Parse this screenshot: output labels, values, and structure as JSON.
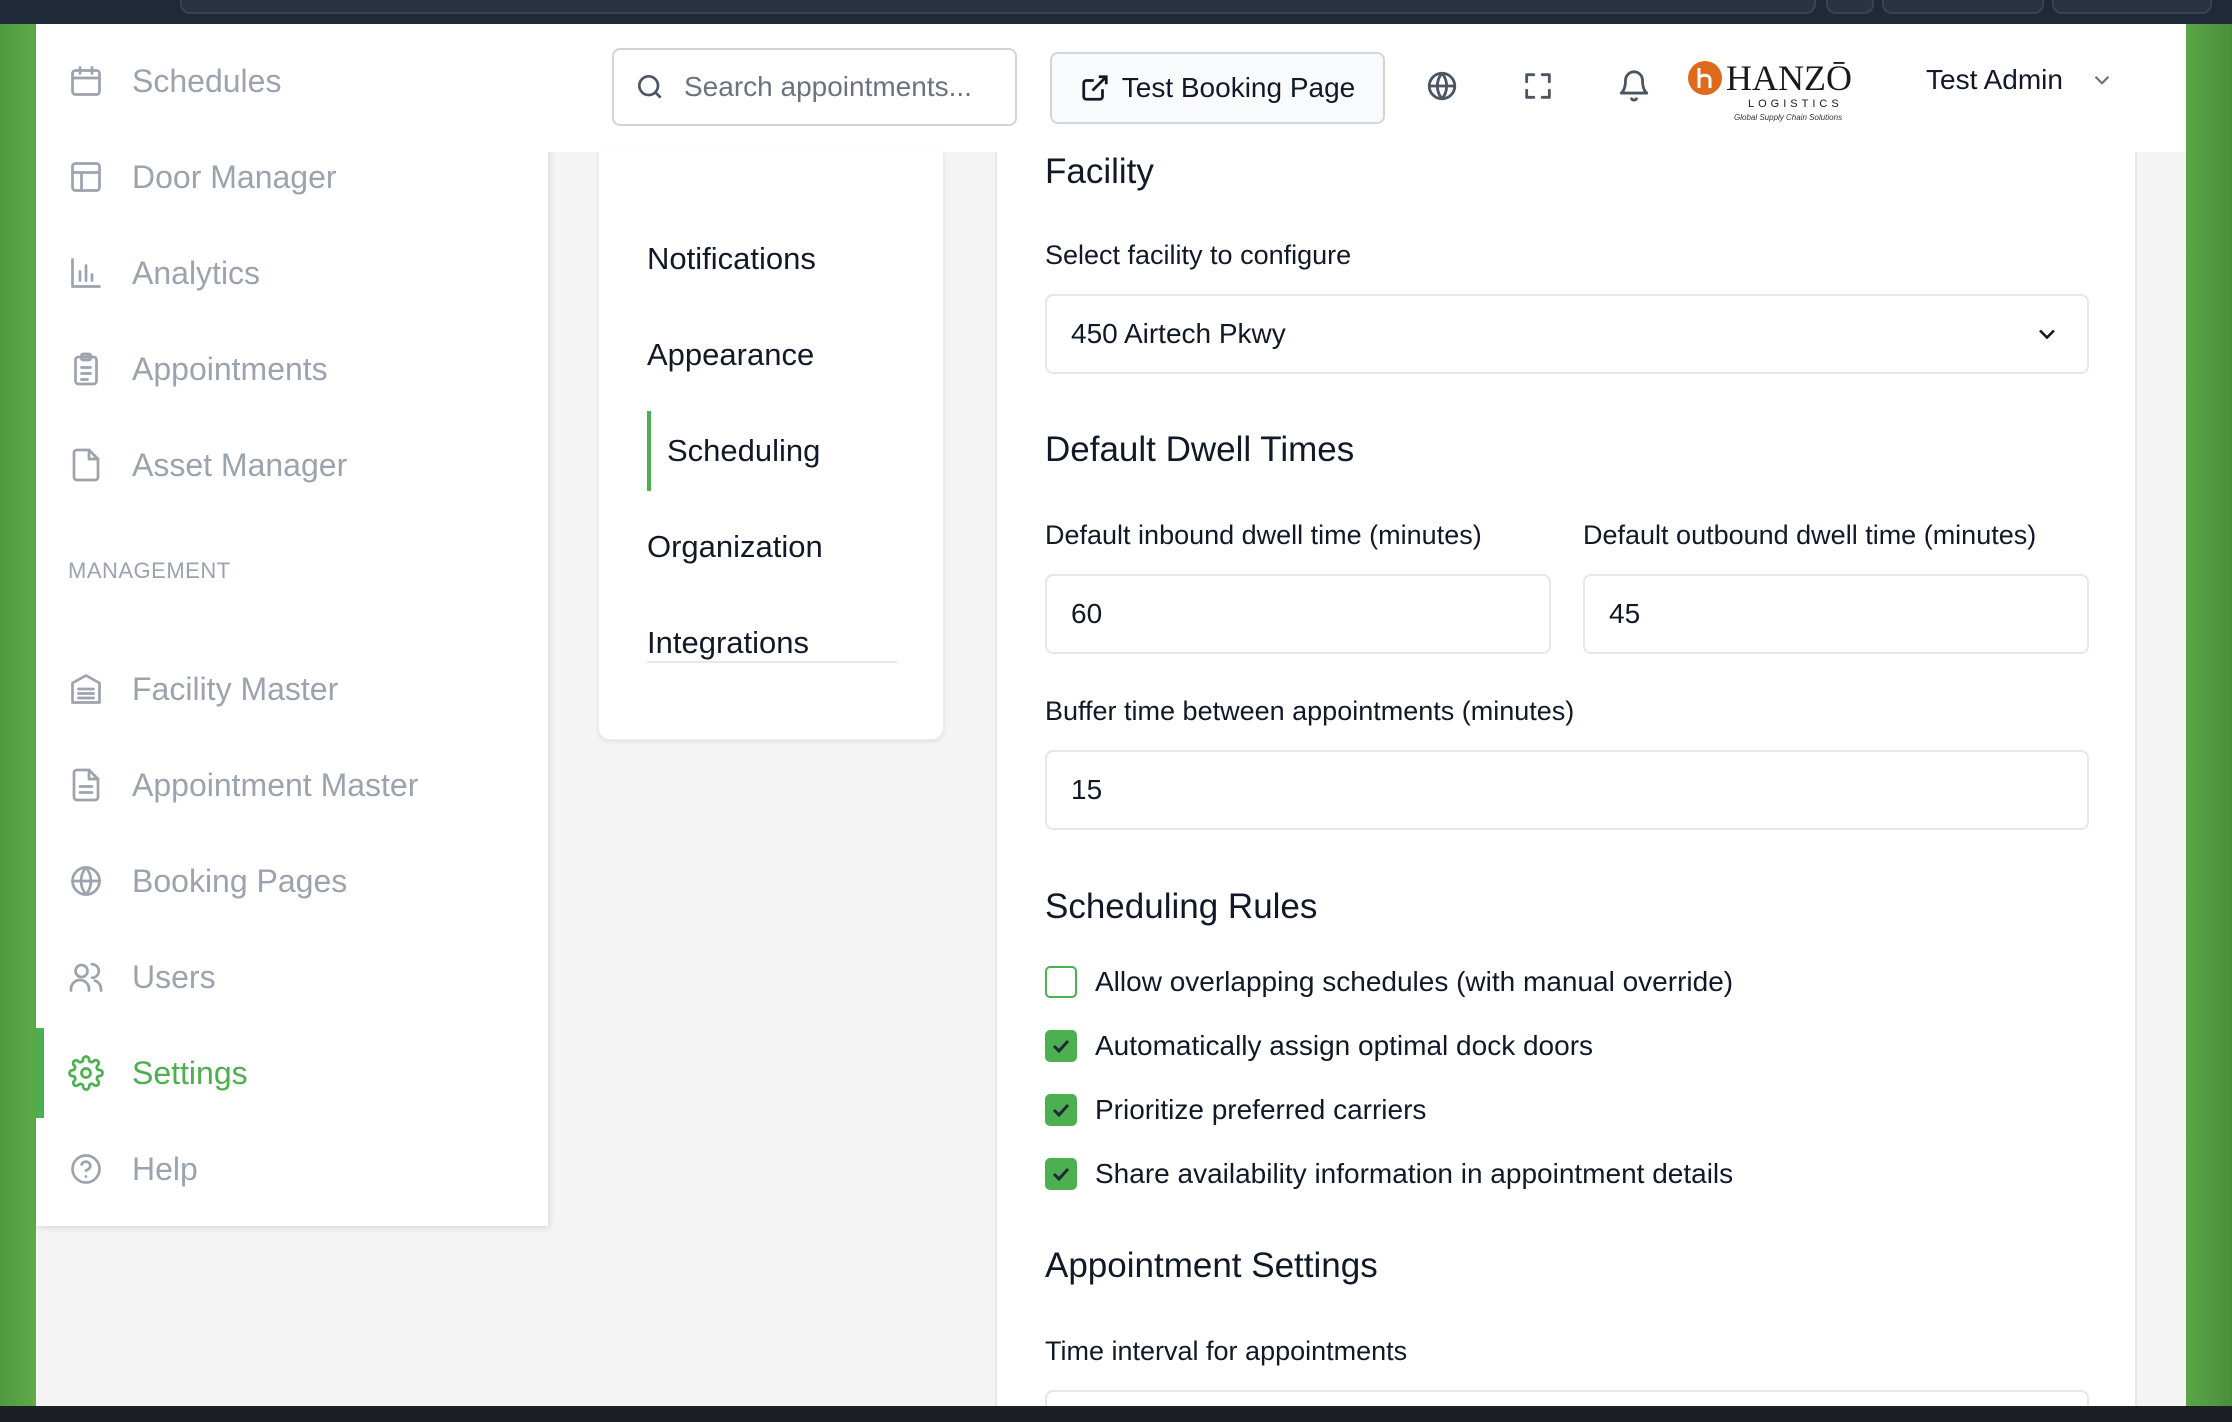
{
  "sidebar": {
    "items": [
      {
        "label": "Schedules",
        "icon": "calendar-icon"
      },
      {
        "label": "Door Manager",
        "icon": "layout-icon"
      },
      {
        "label": "Analytics",
        "icon": "bar-chart-icon"
      },
      {
        "label": "Appointments",
        "icon": "clipboard-icon"
      },
      {
        "label": "Asset Manager",
        "icon": "file-icon"
      }
    ],
    "section_label": "MANAGEMENT",
    "management_items": [
      {
        "label": "Facility Master",
        "icon": "building-icon"
      },
      {
        "label": "Appointment Master",
        "icon": "document-icon"
      },
      {
        "label": "Booking Pages",
        "icon": "globe-icon"
      },
      {
        "label": "Users",
        "icon": "users-icon"
      },
      {
        "label": "Settings",
        "icon": "gear-icon",
        "active": true
      },
      {
        "label": "Help",
        "icon": "help-circle-icon"
      }
    ]
  },
  "header": {
    "search_placeholder": "Search appointments...",
    "test_booking_label": "Test Booking Page",
    "user_name": "Test Admin",
    "logo": {
      "brand": "HANZŌ",
      "sub": "LOGISTICS",
      "tagline": "Global Supply Chain Solutions"
    }
  },
  "settings_nav": {
    "items": [
      "Notifications",
      "Appearance",
      "Scheduling",
      "Organization",
      "Integrations"
    ],
    "active": "Scheduling"
  },
  "content": {
    "facility_heading": "Facility",
    "facility_label": "Select facility to configure",
    "facility_value": "450 Airtech Pkwy",
    "dwell_heading": "Default Dwell Times",
    "inbound_label": "Default inbound dwell time (minutes)",
    "inbound_value": "60",
    "outbound_label": "Default outbound dwell time (minutes)",
    "outbound_value": "45",
    "buffer_label": "Buffer time between appointments (minutes)",
    "buffer_value": "15",
    "rules_heading": "Scheduling Rules",
    "rules": [
      {
        "label": "Allow overlapping schedules (with manual override)",
        "checked": false
      },
      {
        "label": "Automatically assign optimal dock doors",
        "checked": true
      },
      {
        "label": "Prioritize preferred carriers",
        "checked": true
      },
      {
        "label": "Share availability information in appointment details",
        "checked": true
      }
    ],
    "appointment_heading": "Appointment Settings",
    "interval_label": "Time interval for appointments"
  },
  "colors": {
    "accent": "#4caf50",
    "frame_green": "#5aa548"
  }
}
